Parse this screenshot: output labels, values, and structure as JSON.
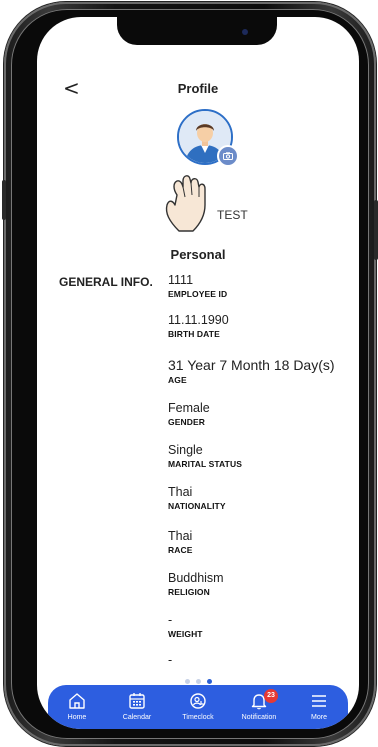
{
  "header": {
    "back_symbol": "<",
    "title": "Profile"
  },
  "user": {
    "name": "TEST"
  },
  "section_title": "Personal",
  "general_label": "GENERAL INFO.",
  "fields": [
    {
      "value": "1111",
      "label": "EMPLOYEE ID"
    },
    {
      "value": "11.11.1990",
      "label": "BIRTH DATE"
    },
    {
      "value": "31 Year 7 Month 18 Day(s)",
      "label": "AGE"
    },
    {
      "value": "Female",
      "label": "GENDER"
    },
    {
      "value": "Single",
      "label": "MARITAL STATUS"
    },
    {
      "value": "Thai",
      "label": "NATIONALITY"
    },
    {
      "value": "Thai",
      "label": "RACE"
    },
    {
      "value": "Buddhism",
      "label": "RELIGION"
    },
    {
      "value": "-",
      "label": "WEIGHT"
    },
    {
      "value": "-",
      "label": ""
    }
  ],
  "pager": {
    "pages": 3,
    "active_index": 2
  },
  "tabbar": {
    "items": [
      {
        "label": "Home",
        "icon": "home-icon"
      },
      {
        "label": "Calendar",
        "icon": "calendar-icon"
      },
      {
        "label": "Timeclock",
        "icon": "timeclock-icon"
      },
      {
        "label": "Notification",
        "icon": "bell-icon",
        "badge": "23"
      },
      {
        "label": "More",
        "icon": "menu-icon"
      }
    ]
  },
  "colors": {
    "accent": "#2d5ee0",
    "badge": "#e53935",
    "avatar_ring": "#2d6fc7"
  }
}
